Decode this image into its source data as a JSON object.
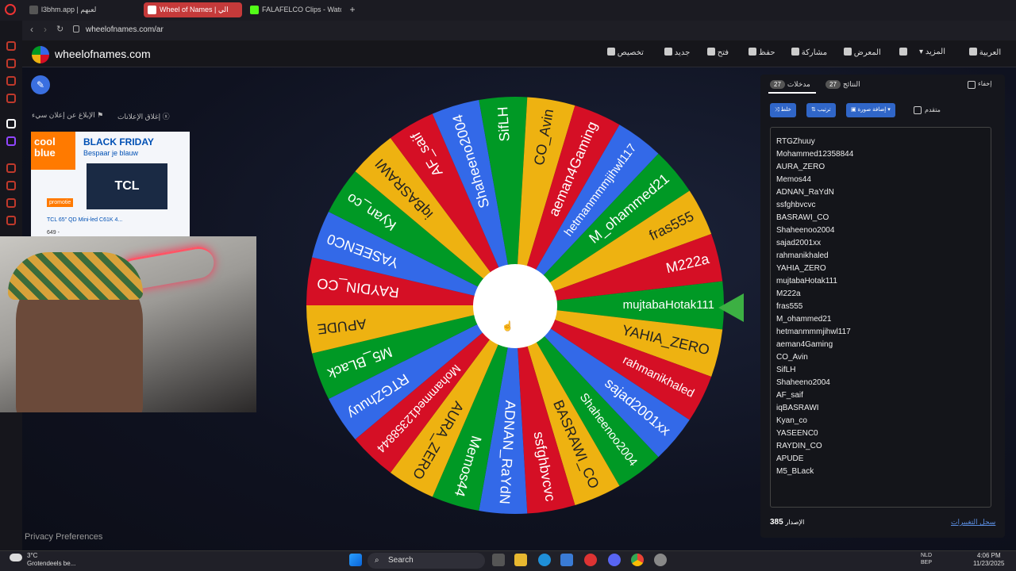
{
  "browser": {
    "tabs": [
      {
        "label": "l3bhm.app | لعبهم"
      },
      {
        "label": "Wheel of Names | الي"
      },
      {
        "label": "FALAFELCO Clips - Watc"
      }
    ],
    "url": "wheelofnames.com/ar"
  },
  "site": {
    "brand": "wheelofnames.com",
    "nav": {
      "customize": "تخصيص",
      "new": "جديد",
      "open": "فتح",
      "save": "حفظ",
      "share": "مشاركة",
      "gallery": "المعرض",
      "more": "المزيد",
      "language": "العربية"
    },
    "ads": {
      "close_ads": "إغلاق الإعلانات",
      "report_ad": "الإبلاغ عن إعلان سيء",
      "brand1": "cool",
      "brand2": "blue",
      "headline": "BLACK FRIDAY",
      "subline": "Bespaar je blauw",
      "tv_brand": "TCL",
      "promo": "promotie",
      "product": "TCL 65\" QD Mini-led C61K 4...",
      "price": "649 -"
    },
    "privacy": "Privacy Preferences"
  },
  "panel": {
    "tab_entries": "مدخلات",
    "tab_entries_count": "27",
    "tab_results": "النتائج",
    "tab_results_count": "27",
    "hide_label": "إخفاء",
    "shuffle": "خلط",
    "sort": "ترتيب",
    "add_image": "إضافة صورة",
    "advanced": "متقدم",
    "entries": [
      "RTGZhuuy",
      "Mohammed12358844",
      "AURA_ZERO",
      "Memos44",
      "ADNAN_RaYdN",
      "ssfghbvcvc",
      "BASRAWI_CO",
      "Shaheenoo2004",
      "sajad2001xx",
      "rahmanikhaled",
      "YAHIA_ZERO",
      "mujtabaHotak111",
      "M222a",
      "fras555",
      "M_ohammed21",
      "hetmanmmmjihwl117",
      "aeman4Gaming",
      "CO_Avin",
      "SifLH",
      "Shaheeno2004",
      "AF_saif",
      "iqBASRAWI",
      "Kyan_co",
      "YASEENC0",
      "RAYDIN_CO",
      "APUDE",
      "M5_BLack"
    ],
    "version_label": "الإصدار",
    "version": "385",
    "changelog": "سجل التغييرات"
  },
  "wheel": {
    "slices": [
      "mujtabaHotak111",
      "YAHIA_ZERO",
      "rahmanikhaled",
      "sajad2001xx",
      "Shaheenoo2004",
      "BASRAWI_CO",
      "ssfghbvcvc",
      "ADNAN_RaYdN",
      "Memos44",
      "AURA_ZERO",
      "Mohammed12358844",
      "RTGZhuuy",
      "M5_BLack",
      "APUDE",
      "RAYDIN_CO",
      "YASEENC0",
      "Kyan_co",
      "iqBASRAWI",
      "AF_saif",
      "Shaheeno2004",
      "SifLH",
      "CO_Avin",
      "aeman4Gaming",
      "hetmanmmmjihwl117",
      "M_ohammed21",
      "fras555",
      "M222a"
    ],
    "colors": [
      "#009925",
      "#eeb211",
      "#d50f25",
      "#3369e8"
    ]
  },
  "taskbar": {
    "temp": "3°C",
    "weather": "Grotendeels be...",
    "search": "Search",
    "lang1": "NLD",
    "lang2": "BEP",
    "time": "4:06 PM",
    "date": "11/23/2025"
  }
}
